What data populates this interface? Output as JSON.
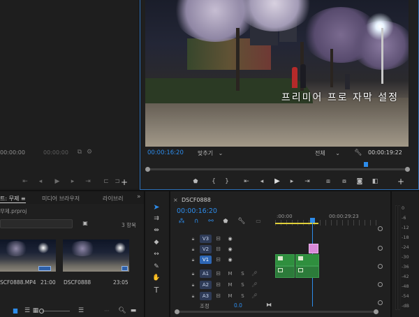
{
  "source_monitor": {
    "timecode": "00:00:00",
    "timecode_right": "00:00:00"
  },
  "program_monitor": {
    "caption": "프리미어 프로 자막 설정",
    "timecode": "00:00:16:20",
    "fit_label": "맞추기",
    "quality_label": "전체",
    "duration": "00:00:19:22",
    "playhead_fraction": 0.84
  },
  "project_panel": {
    "tabs": [
      "트: 무제 ≡",
      "미디어 브라우저",
      "라이브러"
    ],
    "project_file": "무제.prproj",
    "item_count": "3 항목",
    "clips": [
      {
        "name": "SCF0888.MP4",
        "duration": "21:00"
      },
      {
        "name": "DSCF0888",
        "duration": "23:05"
      }
    ]
  },
  "timeline": {
    "tab_label": "DSCF0888",
    "timecode": "00:00:16:20",
    "ruler_start": ":00:00",
    "ruler_mid": "00:00:29:23",
    "tracks": [
      {
        "label": "V3"
      },
      {
        "label": "V2"
      },
      {
        "label": "V1"
      },
      {
        "label": "A1"
      },
      {
        "label": "A2"
      },
      {
        "label": "A3"
      }
    ],
    "master_label": "조정",
    "master_value": "0.0"
  },
  "audio_meter": {
    "ticks": [
      "0",
      "-6",
      "-12",
      "-18",
      "-24",
      "-30",
      "-36",
      "-42",
      "-48",
      "-54",
      "-dB"
    ]
  },
  "colors": {
    "accent_blue": "#2d8ceb",
    "clip_green": "#2f8f3e",
    "title_clip_pink": "#d889d8",
    "work_area_yellow": "#e0d03a"
  }
}
